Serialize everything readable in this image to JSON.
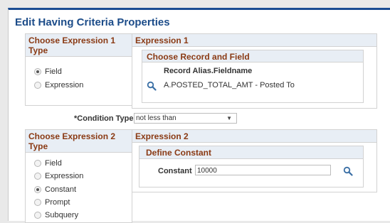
{
  "dialog": {
    "title": "Edit Having Criteria Properties"
  },
  "expr1_type": {
    "header": "Choose Expression 1 Type",
    "options": [
      "Field",
      "Expression"
    ],
    "selected": "Field"
  },
  "expr1": {
    "header": "Expression 1",
    "sub_header": "Choose Record and Field",
    "column_label": "Record Alias.Fieldname",
    "field_value": "A.POSTED_TOTAL_AMT - Posted To",
    "lookup_icon": "magnifier-icon"
  },
  "condition": {
    "label": "*Condition Type",
    "value": "not less than"
  },
  "expr2_type": {
    "header": "Choose Expression 2 Type",
    "options": [
      "Field",
      "Expression",
      "Constant",
      "Prompt",
      "Subquery"
    ],
    "selected": "Constant"
  },
  "expr2": {
    "header": "Expression 2",
    "sub_header": "Define Constant",
    "constant_label": "Constant",
    "constant_value": "10000",
    "lookup_icon": "magnifier-icon"
  },
  "colors": {
    "title": "#1c4c89",
    "section_header_text": "#8a3a14",
    "section_header_bg": "#e8eef5",
    "top_border": "#1a4c93"
  }
}
